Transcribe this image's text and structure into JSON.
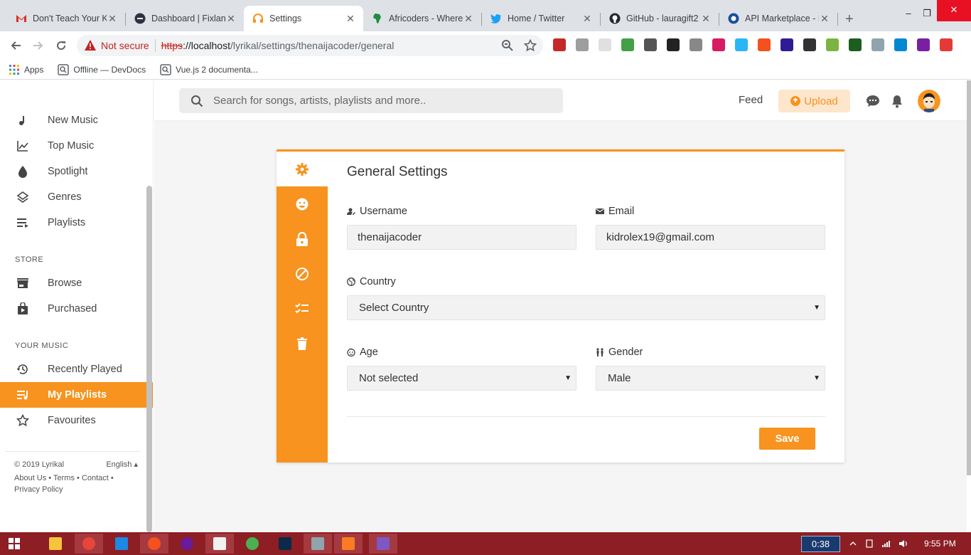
{
  "browser": {
    "tabs": [
      {
        "title": "Don't Teach Your K",
        "icon": "gmail-icon",
        "active": false
      },
      {
        "title": "Dashboard | Fixlanc",
        "icon": "fixlance-icon",
        "active": false
      },
      {
        "title": "Settings",
        "icon": "headphones-icon",
        "active": true
      },
      {
        "title": "Africoders - Where",
        "icon": "africa-icon",
        "active": false
      },
      {
        "title": "Home / Twitter",
        "icon": "twitter-icon",
        "active": false
      },
      {
        "title": "GitHub - lauragift2",
        "icon": "github-icon",
        "active": false
      },
      {
        "title": "API Marketplace - F",
        "icon": "rapidapi-icon",
        "active": false
      }
    ],
    "new_tab": "+",
    "window_controls": {
      "minimize": "–",
      "restore": "❐",
      "close": "✕"
    },
    "security_label": "Not secure",
    "url": {
      "scheme": "https",
      "host": "://localhost",
      "path": "/lyrikal/settings/thenaijacoder/general"
    },
    "bookmarks": [
      {
        "label": "Apps",
        "icon": "apps-grid-icon"
      },
      {
        "label": "Offline — DevDocs",
        "icon": "devdocs-icon"
      },
      {
        "label": "Vue.js 2 documenta...",
        "icon": "devdocs-icon"
      }
    ],
    "extension_colors": [
      "#c62828",
      "#9e9e9e",
      "#e0e0e0",
      "#43a047",
      "#555555",
      "#222222",
      "#888888",
      "#d81b60",
      "#29b6f6",
      "#f4511e",
      "#311b92",
      "#333333",
      "#7cb342",
      "#1b5e20",
      "#90a4ae",
      "#0288d1",
      "#7b1fa2",
      "#e53935"
    ]
  },
  "sidebar": {
    "items": [
      {
        "label": "New Music",
        "icon": "music-note-icon"
      },
      {
        "label": "Top Music",
        "icon": "chart-line-icon"
      },
      {
        "label": "Spotlight",
        "icon": "drop-icon"
      },
      {
        "label": "Genres",
        "icon": "layers-icon"
      },
      {
        "label": "Playlists",
        "icon": "playlist-icon"
      }
    ],
    "store_heading": "STORE",
    "store_items": [
      {
        "label": "Browse",
        "icon": "store-icon"
      },
      {
        "label": "Purchased",
        "icon": "shopping-bag-icon"
      }
    ],
    "music_heading": "YOUR MUSIC",
    "music_items": [
      {
        "label": "Recently Played",
        "icon": "history-icon"
      },
      {
        "label": "My Playlists",
        "icon": "playlist-play-icon",
        "active": true
      },
      {
        "label": "Favourites",
        "icon": "star-icon"
      }
    ],
    "footer": {
      "copyright": "© 2019 Lyrikal",
      "language": "English ▴",
      "links_line1": "About Us • Terms • Contact •",
      "links_line2": "Privacy Policy"
    }
  },
  "header": {
    "search_placeholder": "Search for songs, artists, playlists and more..",
    "feed_label": "Feed",
    "upload_label": "Upload"
  },
  "settings": {
    "title": "General Settings",
    "tabs": [
      {
        "icon": "gear-icon",
        "active": true
      },
      {
        "icon": "face-icon"
      },
      {
        "icon": "lock-icon"
      },
      {
        "icon": "block-icon"
      },
      {
        "icon": "checklist-icon"
      },
      {
        "icon": "trash-icon"
      }
    ],
    "username": {
      "label": "Username",
      "value": "thenaijacoder"
    },
    "email": {
      "label": "Email",
      "value": "kidrolex19@gmail.com"
    },
    "country": {
      "label": "Country",
      "value": "Select Country"
    },
    "age": {
      "label": "Age",
      "value": "Not selected"
    },
    "gender": {
      "label": "Gender",
      "value": "Male"
    },
    "save_label": "Save"
  },
  "taskbar": {
    "timer": "0:38",
    "clock": "9:55 PM"
  },
  "colors": {
    "accent": "#f7931e",
    "accent_light": "#fde6cc",
    "taskbar": "#8c1e24"
  }
}
